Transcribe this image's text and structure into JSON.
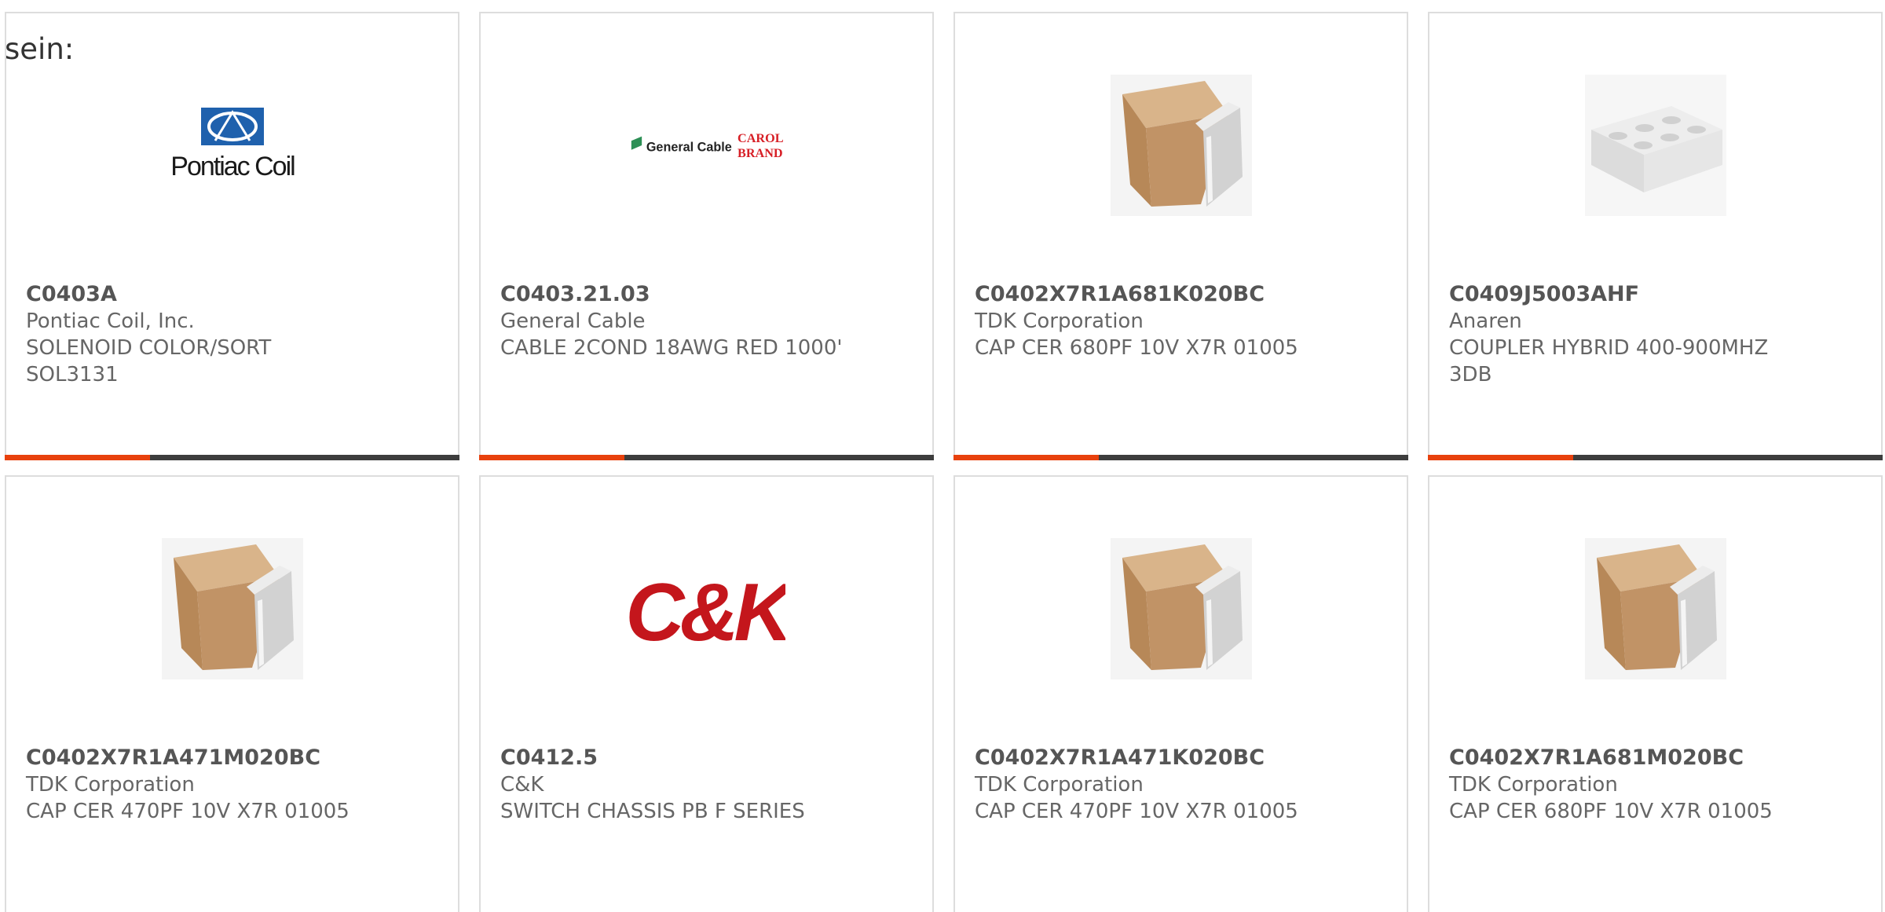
{
  "header": {
    "label": "sein:"
  },
  "products": [
    {
      "part": "C0403A",
      "manufacturer": "Pontiac Coil, Inc.",
      "description": "SOLENOID COLOR/SORT\nSOL3131",
      "image_icon": "pontiac-coil-logo",
      "logo_text": "Pontiac Coil"
    },
    {
      "part": "C0403.21.03",
      "manufacturer": "General Cable",
      "description": "CABLE 2COND 18AWG RED 1000'",
      "image_icon": "general-cable-logo",
      "logo_text": "General Cable",
      "logo_text2": "CAROL",
      "logo_text3": "BRAND"
    },
    {
      "part": "C0402X7R1A681K020BC",
      "manufacturer": "TDK Corporation",
      "description": "CAP CER 680PF 10V X7R 01005",
      "image_icon": "ceramic-capacitor-chip"
    },
    {
      "part": "C0409J5003AHF",
      "manufacturer": "Anaren",
      "description": "COUPLER HYBRID 400-900MHZ\n3DB",
      "image_icon": "coupler-chip"
    },
    {
      "part": "C0402X7R1A471M020BC",
      "manufacturer": "TDK Corporation",
      "description": "CAP CER 470PF 10V X7R 01005",
      "image_icon": "ceramic-capacitor-chip"
    },
    {
      "part": "C0412.5",
      "manufacturer": "C&K",
      "description": "SWITCH CHASSIS PB F SERIES",
      "image_icon": "ck-logo",
      "logo_text": "C&K"
    },
    {
      "part": "C0402X7R1A471K020BC",
      "manufacturer": "TDK Corporation",
      "description": "CAP CER 470PF 10V X7R 01005",
      "image_icon": "ceramic-capacitor-chip"
    },
    {
      "part": "C0402X7R1A681M020BC",
      "manufacturer": "TDK Corporation",
      "description": "CAP CER 680PF 10V X7R 01005",
      "image_icon": "ceramic-capacitor-chip"
    }
  ],
  "colors": {
    "accent": "#e8410d",
    "bar_dark": "#3d3d3d",
    "border": "#dddddd",
    "part_text": "#555555",
    "body_text": "#666666"
  }
}
